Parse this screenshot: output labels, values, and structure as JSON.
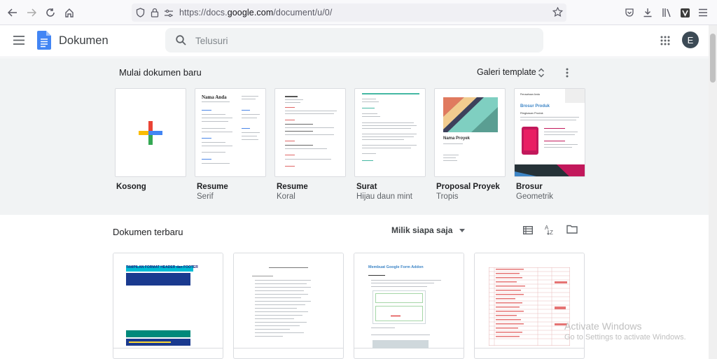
{
  "browser": {
    "url_prefix": "https://docs.",
    "url_domain": "google.com",
    "url_path": "/document/u/0/"
  },
  "app": {
    "name": "Dokumen",
    "search_placeholder": "Telusuri",
    "avatar_letter": "E"
  },
  "templates": {
    "title": "Mulai dokumen baru",
    "gallery_label": "Galeri template",
    "items": [
      {
        "name": "Kosong",
        "sub": ""
      },
      {
        "name": "Resume",
        "sub": "Serif"
      },
      {
        "name": "Resume",
        "sub": "Koral"
      },
      {
        "name": "Surat",
        "sub": "Hijau daun mint"
      },
      {
        "name": "Proposal Proyek",
        "sub": "Tropis"
      },
      {
        "name": "Brosur",
        "sub": "Geometrik"
      }
    ],
    "thumb_text": {
      "resume_name": "Nama Anda",
      "proposal_title": "Nama Proyek",
      "brochure_title": "Brosur Produk",
      "brochure_company": "Perusahaan Anda",
      "brochure_sub": "Ringkasan Produk"
    }
  },
  "recent": {
    "title": "Dokumen terbaru",
    "owner_filter": "Milik siapa saja",
    "docs": [
      {
        "thumb_heading": "TAMPILAN FORMAT HEADER dan FOOTER"
      },
      {
        "thumb_heading": ""
      },
      {
        "thumb_heading": "Membuat Google Form Addon"
      },
      {
        "thumb_heading": ""
      }
    ]
  },
  "watermark": {
    "line1": "Activate Windows",
    "line2": "Go to Settings to activate Windows."
  },
  "colors": {
    "google_blue": "#4285f4",
    "google_red": "#ea4335",
    "google_yellow": "#fbbc04",
    "google_green": "#34a853"
  }
}
